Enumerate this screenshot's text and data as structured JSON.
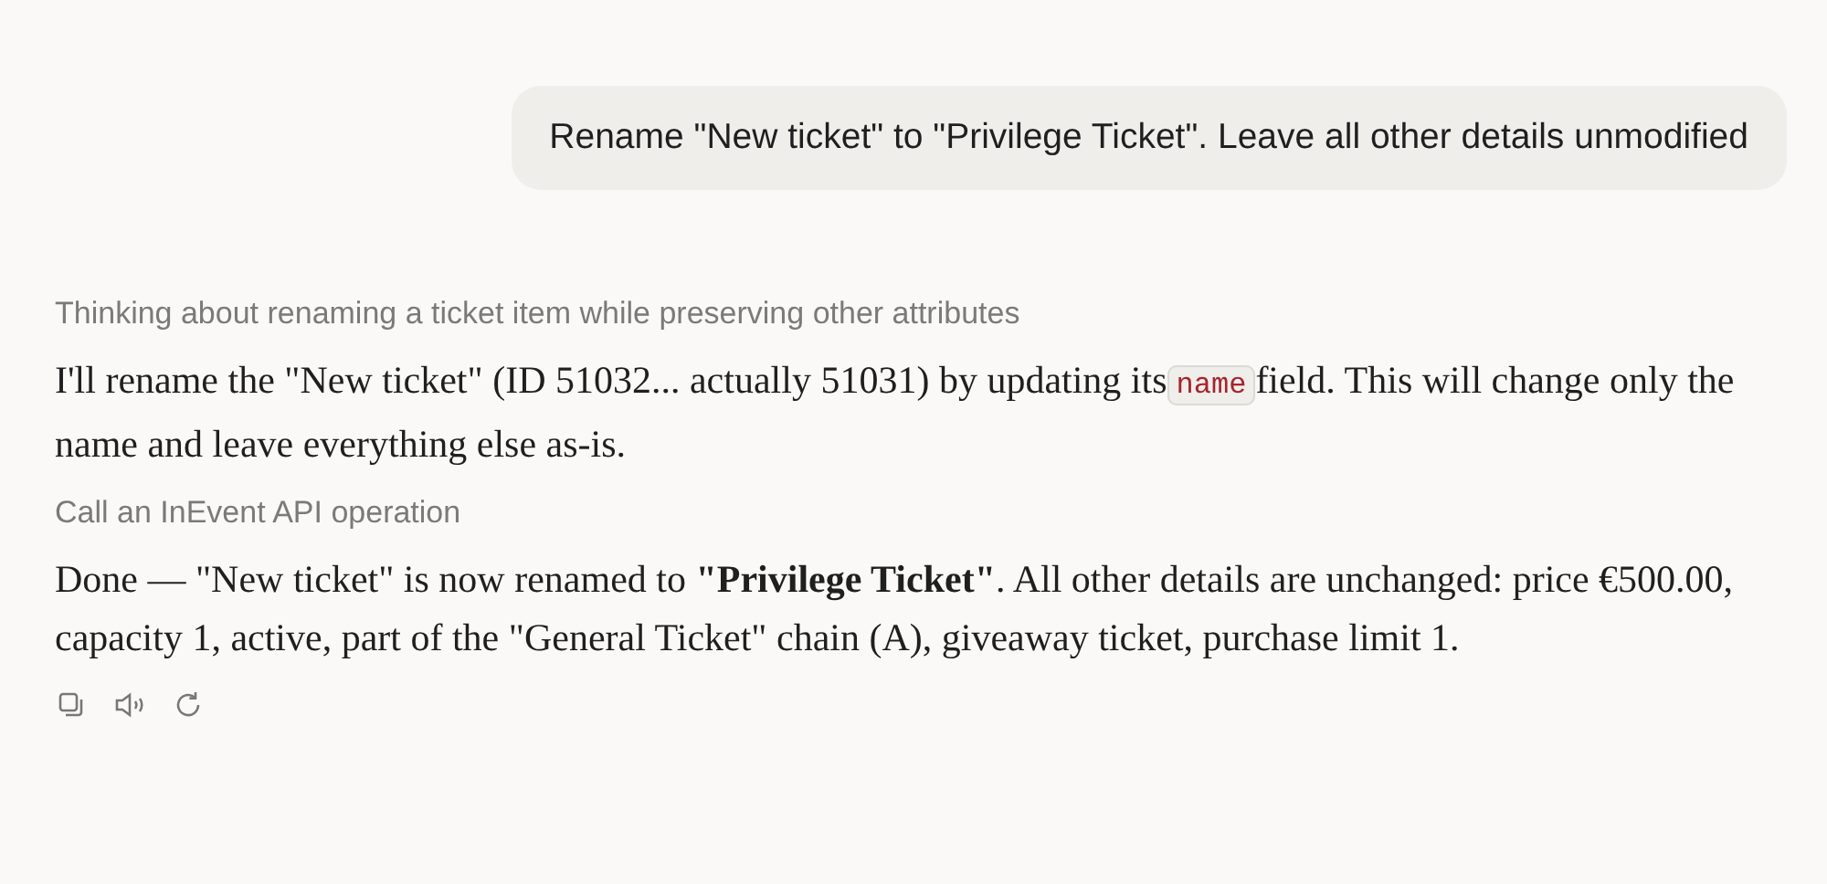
{
  "user_message": "Rename \"New ticket\" to \"Privilege Ticket\". Leave all other details unmodified",
  "response": [
    {
      "kind": "status",
      "text": "Thinking about renaming a ticket item while preserving other attributes"
    },
    {
      "kind": "paragraph",
      "before": "I'll rename the \"New ticket\" (ID 51032... actually 51031) by updating its",
      "code": "name",
      "after": "field. This will change only the name and leave everything else as-is."
    },
    {
      "kind": "status",
      "text": "Call an InEvent API operation"
    },
    {
      "kind": "paragraph",
      "before": "Done — \"New ticket\" is now renamed to **\"Privilege Ticket\"**. All other details are unchanged: price €500.00, capacity 1, active, part of the \"General Ticket\" chain (A), giveaway ticket, purchase limit 1."
    }
  ],
  "actions": [
    {
      "kind": "copy"
    },
    {
      "kind": "speak"
    },
    {
      "kind": "retry"
    }
  ]
}
